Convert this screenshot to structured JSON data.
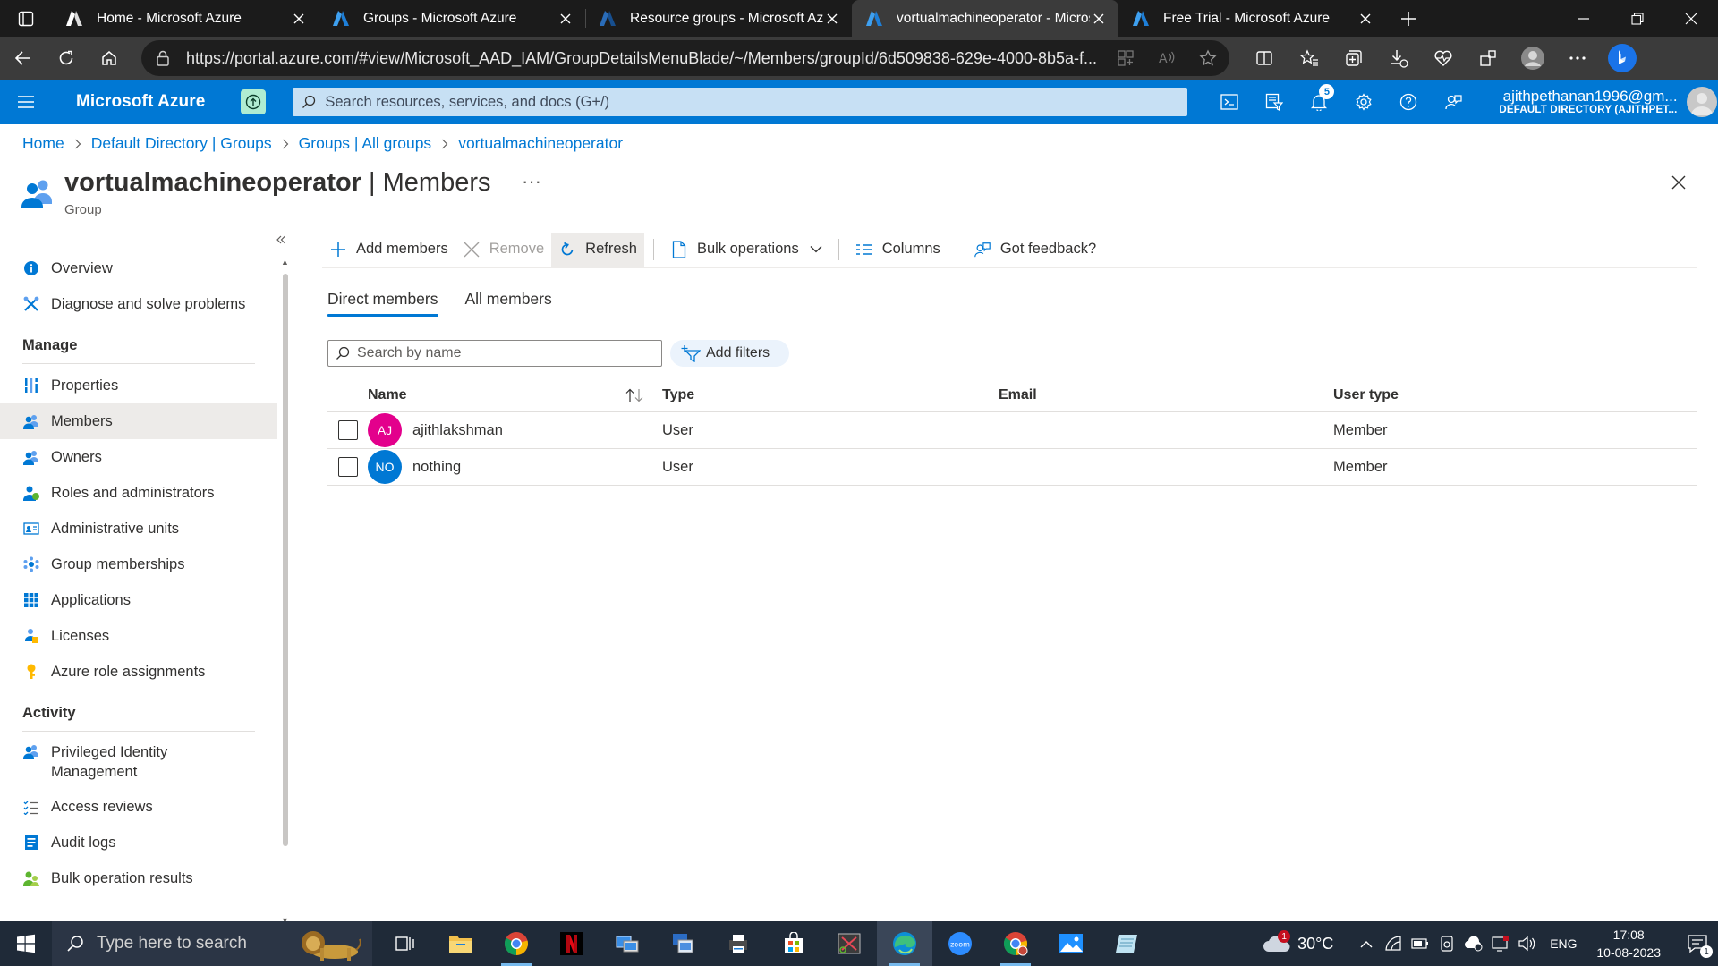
{
  "browser": {
    "tabs": [
      {
        "title": "Home - Microsoft Azure",
        "active": false
      },
      {
        "title": "Groups - Microsoft Azure",
        "active": false
      },
      {
        "title": "Resource groups - Microsoft Azu",
        "active": false
      },
      {
        "title": "vortualmachineoperator - Micros",
        "active": true
      },
      {
        "title": "Free Trial - Microsoft Azure",
        "active": false
      }
    ],
    "url": "https://portal.azure.com/#view/Microsoft_AAD_IAM/GroupDetailsMenuBlade/~/Members/groupId/6d509838-629e-4000-8b5a-f..."
  },
  "azure": {
    "brand": "Microsoft Azure",
    "search_placeholder": "Search resources, services, and docs (G+/)",
    "notification_count": "5",
    "account_email": "ajithpethanan1996@gm...",
    "account_directory": "DEFAULT DIRECTORY (AJITHPET..."
  },
  "breadcrumb": [
    "Home",
    "Default Directory | Groups",
    "Groups | All groups",
    "vortualmachineoperator"
  ],
  "blade": {
    "title_bold": "vortualmachineoperator",
    "title_rest": " | Members",
    "subtitle": "Group",
    "ellipsis": "···"
  },
  "leftnav": {
    "top": [
      {
        "label": "Overview",
        "icon": "info-icon"
      },
      {
        "label": "Diagnose and solve problems",
        "icon": "wrench-icon"
      }
    ],
    "manage_heading": "Manage",
    "manage": [
      {
        "label": "Properties",
        "icon": "properties-icon"
      },
      {
        "label": "Members",
        "icon": "members-icon",
        "selected": true
      },
      {
        "label": "Owners",
        "icon": "owners-icon"
      },
      {
        "label": "Roles and administrators",
        "icon": "roles-icon"
      },
      {
        "label": "Administrative units",
        "icon": "admin-units-icon"
      },
      {
        "label": "Group memberships",
        "icon": "group-memberships-icon"
      },
      {
        "label": "Applications",
        "icon": "applications-icon"
      },
      {
        "label": "Licenses",
        "icon": "licenses-icon"
      },
      {
        "label": "Azure role assignments",
        "icon": "key-icon"
      }
    ],
    "activity_heading": "Activity",
    "activity": [
      {
        "label": "Privileged Identity Management",
        "icon": "pim-icon"
      },
      {
        "label": "Access reviews",
        "icon": "access-reviews-icon"
      },
      {
        "label": "Audit logs",
        "icon": "audit-logs-icon"
      },
      {
        "label": "Bulk operation results",
        "icon": "bulk-results-icon"
      }
    ]
  },
  "commands": {
    "add_members": "Add members",
    "remove": "Remove",
    "refresh": "Refresh",
    "bulk_operations": "Bulk operations",
    "columns": "Columns",
    "feedback": "Got feedback?"
  },
  "pivots": {
    "direct": "Direct members",
    "all": "All members"
  },
  "filters": {
    "search_placeholder": "Search by name",
    "add_filters": "Add filters"
  },
  "table": {
    "columns": {
      "name": "Name",
      "type": "Type",
      "email": "Email",
      "user_type": "User type"
    },
    "rows": [
      {
        "initials": "AJ",
        "avatar_color": "#e3008c",
        "name": "ajithlakshman",
        "type": "User",
        "email": "",
        "user_type": "Member"
      },
      {
        "initials": "NO",
        "avatar_color": "#0078d4",
        "name": "nothing",
        "type": "User",
        "email": "",
        "user_type": "Member"
      }
    ]
  },
  "taskbar": {
    "search_placeholder": "Type here to search",
    "weather_temp": "30°C",
    "weather_badge": "1",
    "language": "ENG",
    "time": "17:08",
    "date": "10-08-2023",
    "notification_count": "1"
  }
}
